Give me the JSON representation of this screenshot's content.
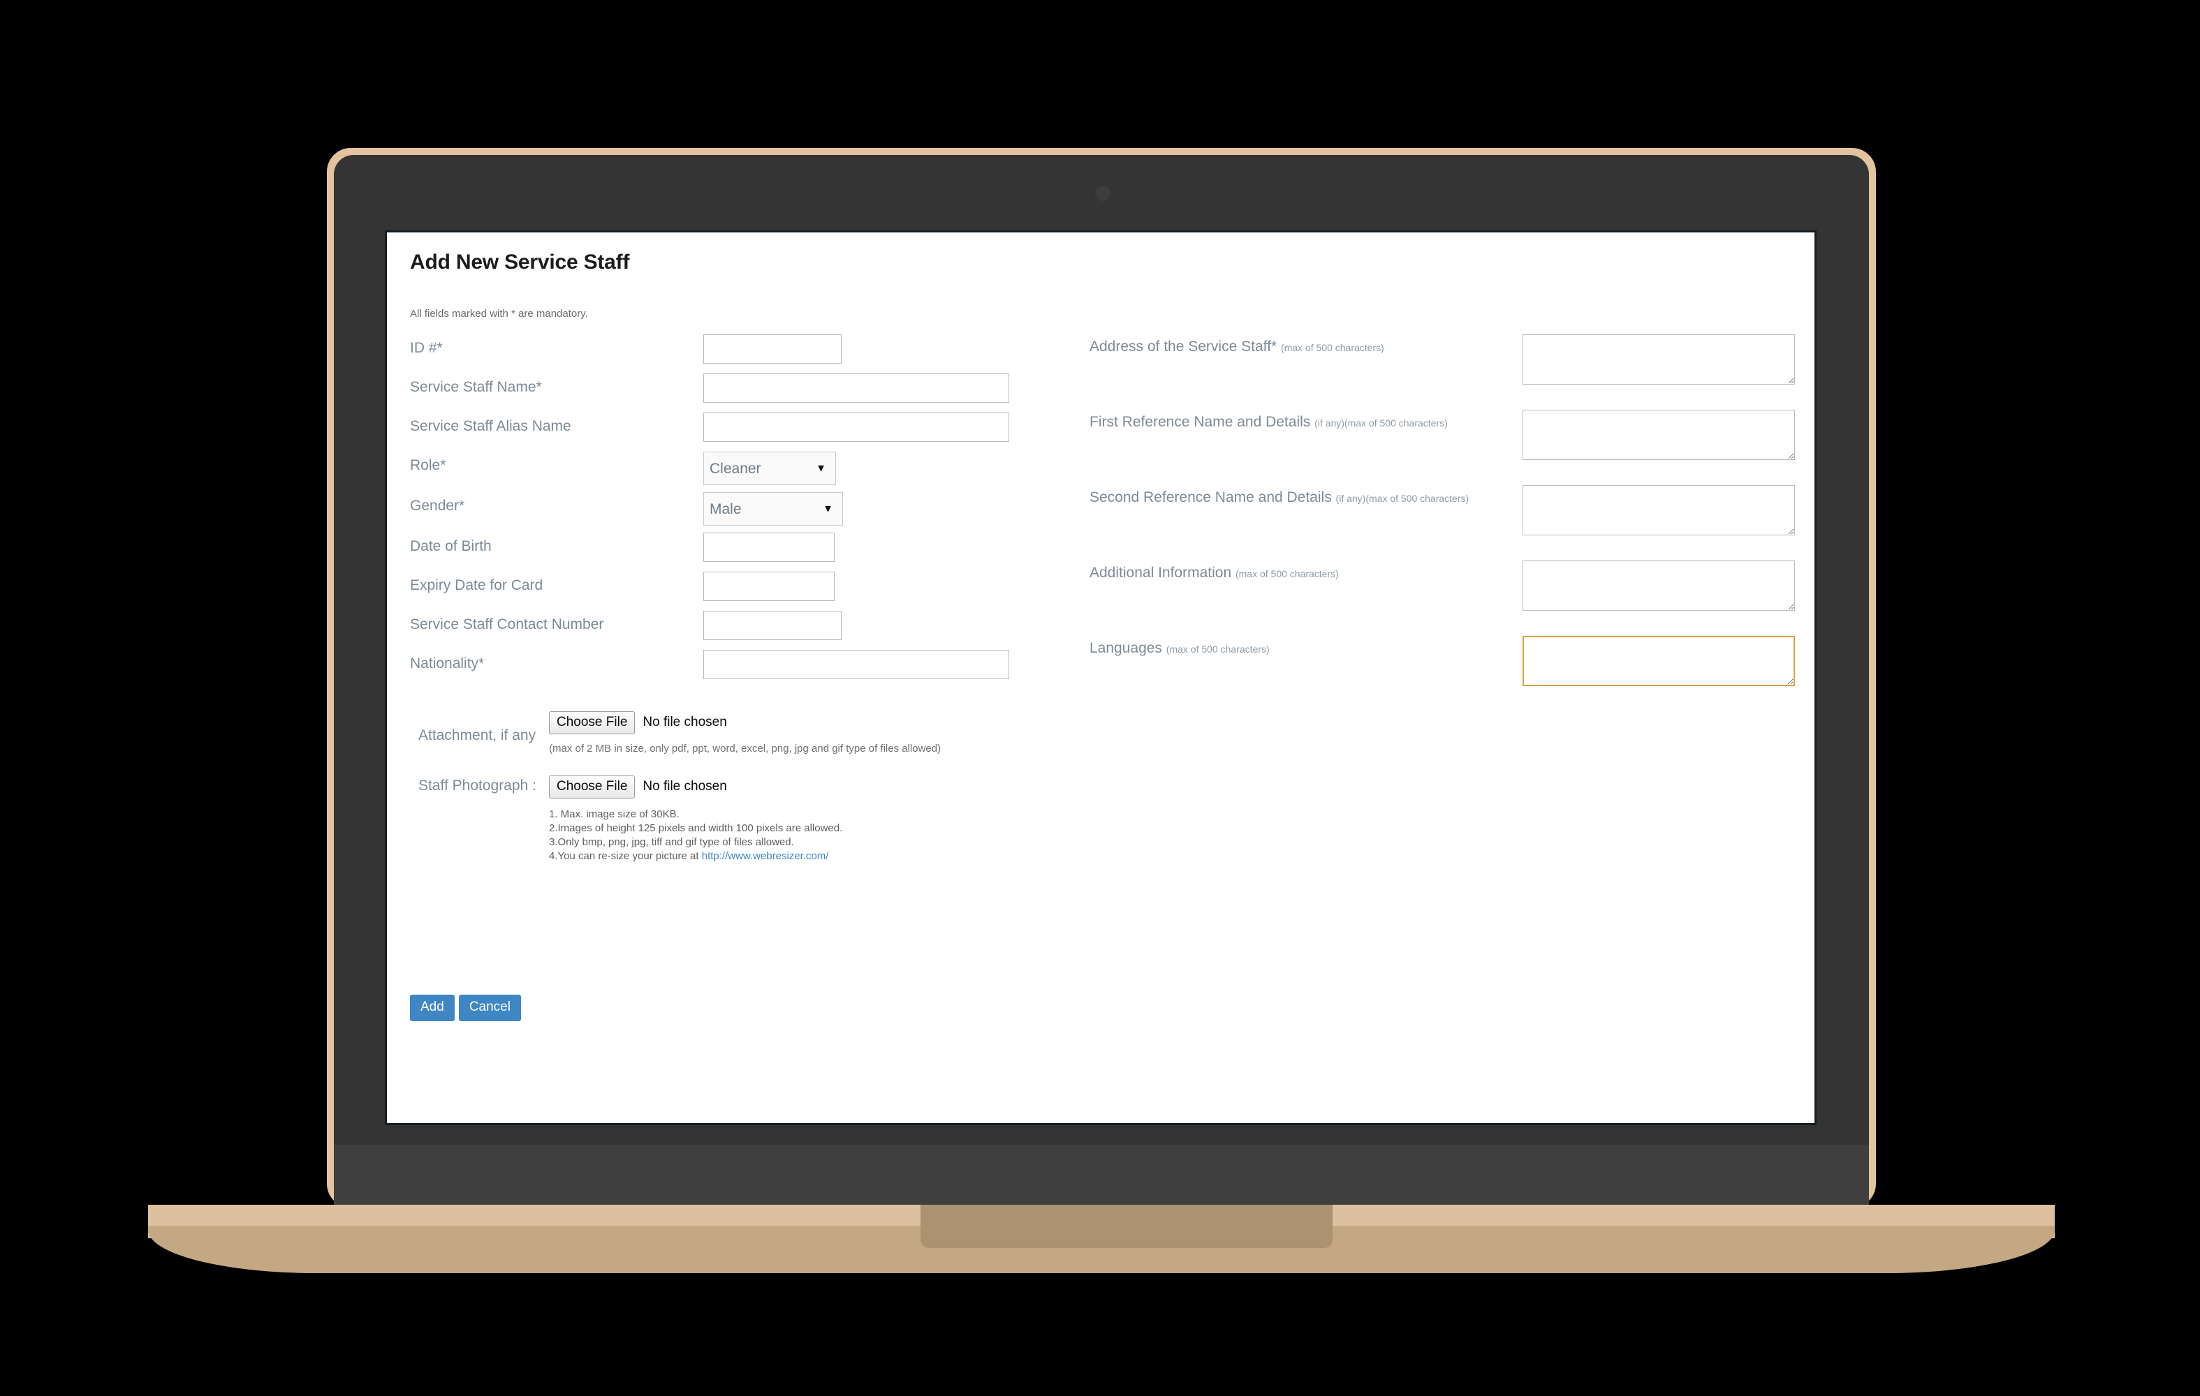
{
  "page": {
    "title": "Add New Service Staff",
    "mandatory_note": "All fields marked with * are mandatory."
  },
  "left_fields": [
    {
      "label": "ID #*",
      "type": "text",
      "value": "",
      "width": "narrow"
    },
    {
      "label": "Service Staff Name*",
      "type": "text",
      "value": "",
      "width": "wide"
    },
    {
      "label": "Service Staff Alias Name",
      "type": "text",
      "value": "",
      "width": "wide"
    },
    {
      "label": "Role*",
      "type": "select",
      "value": "Cleaner"
    },
    {
      "label": "Gender*",
      "type": "select",
      "value": "Male"
    },
    {
      "label": "Date of Birth",
      "type": "text",
      "value": "",
      "width": "mid"
    },
    {
      "label": "Expiry Date for Card",
      "type": "text",
      "value": "",
      "width": "mid"
    },
    {
      "label": "Service Staff Contact Number",
      "type": "text",
      "value": "",
      "width": "narrow"
    },
    {
      "label": "Nationality*",
      "type": "text",
      "value": "",
      "width": "wide"
    }
  ],
  "left_labels": {
    "id": "ID #*",
    "name": "Service Staff Name*",
    "alias": "Service Staff Alias Name",
    "role": "Role*",
    "gender": "Gender*",
    "dob": "Date of Birth",
    "expiry": "Expiry Date for Card",
    "contact": "Service Staff Contact Number",
    "nationality": "Nationality*"
  },
  "selects": {
    "role": {
      "value": "Cleaner",
      "options": [
        "Cleaner"
      ]
    },
    "gender": {
      "value": "Male",
      "options": [
        "Male"
      ]
    }
  },
  "right_fields": {
    "address": {
      "label": "Address of the Service Staff*",
      "hint": "(max of 500 characters)",
      "value": "",
      "focused": false
    },
    "first_reference": {
      "label": "First Reference Name and Details",
      "hint": "(if any)(max of 500 characters)",
      "value": "",
      "focused": false
    },
    "second_reference": {
      "label": "Second Reference Name and Details",
      "hint": "(if any)(max of 500 characters)",
      "value": "",
      "focused": false
    },
    "additional_information": {
      "label": "Additional Information",
      "hint": "(max of 500 characters)",
      "value": "",
      "focused": false
    },
    "languages": {
      "label": "Languages",
      "hint": "(max of 500 characters)",
      "value": "",
      "focused": true
    }
  },
  "attachment": {
    "label": "Attachment, if any",
    "choose_button": "Choose File",
    "file_status": "No file chosen",
    "hint": "(max of 2 MB in size, only pdf, ppt, word, excel, png, jpg and gif type of files allowed)"
  },
  "photograph": {
    "label": "Staff Photograph :",
    "choose_button": "Choose File",
    "file_status": "No file chosen",
    "rules": [
      "1. Max. image size of 30KB.",
      "2.Images of height 125 pixels and width 100 pixels are allowed.",
      "3.Only bmp, png, jpg, tiff and gif type of files allowed.",
      "4.You can re-size your picture at "
    ],
    "link_text": "http://www.webresizer.com/"
  },
  "actions": {
    "add": "Add",
    "cancel": "Cancel"
  },
  "colors": {
    "accent_button": "#3f86c4",
    "link": "#3f86c4",
    "label_text": "#7d8a94",
    "focus_border": "#d9a44a",
    "laptop_bezel": "#e3c49f",
    "laptop_body": "#343434",
    "laptop_base": "#c4a883"
  },
  "icons": {
    "select_arrow": "▼",
    "webcam": "webcam-dot"
  }
}
